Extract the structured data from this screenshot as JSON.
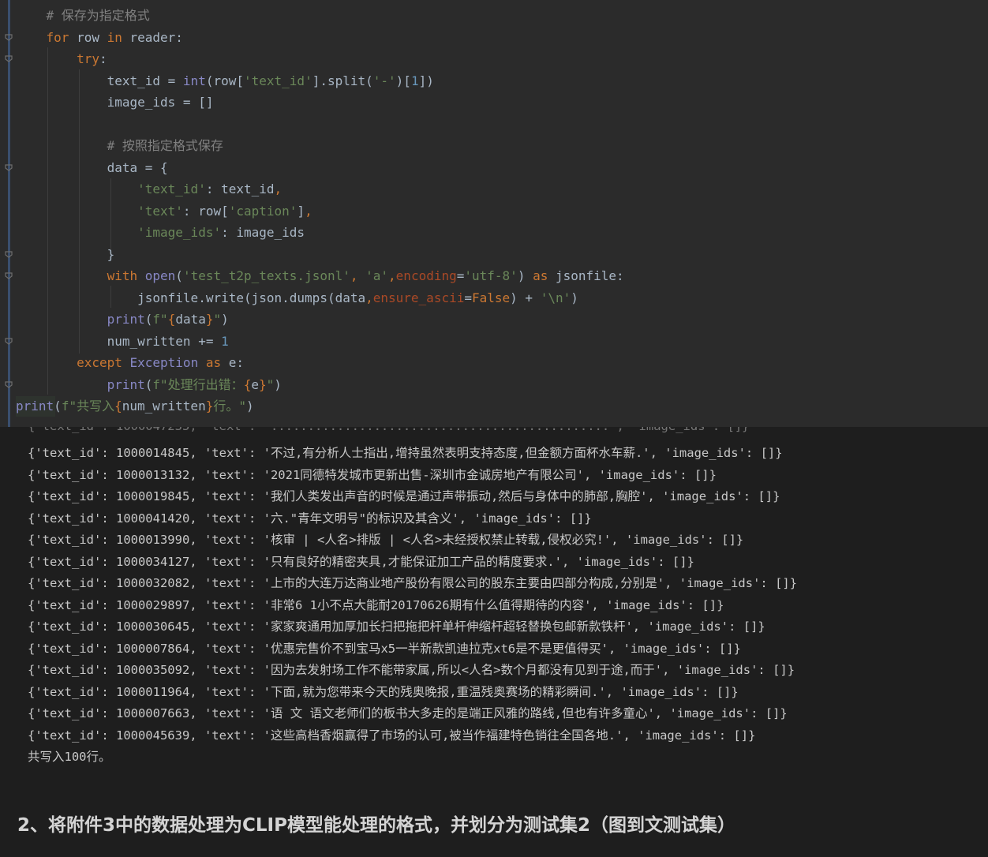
{
  "editor": {
    "lines": [
      [
        {
          "t": "    # 保存为指定格式",
          "c": "cmt"
        }
      ],
      [
        {
          "t": "    ",
          "c": "plain"
        },
        {
          "t": "for",
          "c": "kw"
        },
        {
          "t": " row ",
          "c": "plain"
        },
        {
          "t": "in",
          "c": "kw"
        },
        {
          "t": " reader:",
          "c": "plain"
        }
      ],
      [
        {
          "t": "        ",
          "c": "plain"
        },
        {
          "t": "try",
          "c": "kw"
        },
        {
          "t": ":",
          "c": "plain"
        }
      ],
      [
        {
          "t": "            text_id = ",
          "c": "plain"
        },
        {
          "t": "int",
          "c": "bi"
        },
        {
          "t": "(row[",
          "c": "plain"
        },
        {
          "t": "'text_id'",
          "c": "str"
        },
        {
          "t": "].split(",
          "c": "plain"
        },
        {
          "t": "'-'",
          "c": "str"
        },
        {
          "t": ")[",
          "c": "plain"
        },
        {
          "t": "1",
          "c": "num"
        },
        {
          "t": "])",
          "c": "plain"
        }
      ],
      [
        {
          "t": "            image_ids = []",
          "c": "plain"
        }
      ],
      [
        {
          "t": "",
          "c": "plain"
        }
      ],
      [
        {
          "t": "            # 按照指定格式保存",
          "c": "cmt"
        }
      ],
      [
        {
          "t": "            data = {",
          "c": "plain"
        }
      ],
      [
        {
          "t": "                ",
          "c": "plain"
        },
        {
          "t": "'text_id'",
          "c": "str"
        },
        {
          "t": ": text_id",
          "c": "plain"
        },
        {
          "t": ",",
          "c": "kw"
        }
      ],
      [
        {
          "t": "                ",
          "c": "plain"
        },
        {
          "t": "'text'",
          "c": "str"
        },
        {
          "t": ": row[",
          "c": "plain"
        },
        {
          "t": "'caption'",
          "c": "str"
        },
        {
          "t": "]",
          "c": "plain"
        },
        {
          "t": ",",
          "c": "kw"
        }
      ],
      [
        {
          "t": "                ",
          "c": "plain"
        },
        {
          "t": "'image_ids'",
          "c": "str"
        },
        {
          "t": ": image_ids",
          "c": "plain"
        }
      ],
      [
        {
          "t": "            }",
          "c": "plain"
        }
      ],
      [
        {
          "t": "            ",
          "c": "plain"
        },
        {
          "t": "with",
          "c": "kw"
        },
        {
          "t": " ",
          "c": "plain"
        },
        {
          "t": "open",
          "c": "bi"
        },
        {
          "t": "(",
          "c": "plain"
        },
        {
          "t": "'test_t2p_texts.jsonl'",
          "c": "str"
        },
        {
          "t": ", ",
          "c": "kw"
        },
        {
          "t": "'a'",
          "c": "str"
        },
        {
          "t": ",",
          "c": "kw"
        },
        {
          "t": "encoding",
          "c": "param"
        },
        {
          "t": "=",
          "c": "plain"
        },
        {
          "t": "'utf-8'",
          "c": "str"
        },
        {
          "t": ") ",
          "c": "plain"
        },
        {
          "t": "as",
          "c": "kw"
        },
        {
          "t": " jsonfile:",
          "c": "plain"
        }
      ],
      [
        {
          "t": "                jsonfile.write(json.dumps(data",
          "c": "plain"
        },
        {
          "t": ",",
          "c": "kw"
        },
        {
          "t": "ensure_ascii",
          "c": "param"
        },
        {
          "t": "=",
          "c": "plain"
        },
        {
          "t": "False",
          "c": "kw"
        },
        {
          "t": ") + ",
          "c": "plain"
        },
        {
          "t": "'\\n'",
          "c": "str"
        },
        {
          "t": ")",
          "c": "plain"
        }
      ],
      [
        {
          "t": "            ",
          "c": "plain"
        },
        {
          "t": "print",
          "c": "bi"
        },
        {
          "t": "(",
          "c": "plain"
        },
        {
          "t": "f\"",
          "c": "str"
        },
        {
          "t": "{",
          "c": "kw"
        },
        {
          "t": "data",
          "c": "plain"
        },
        {
          "t": "}",
          "c": "kw"
        },
        {
          "t": "\"",
          "c": "str"
        },
        {
          "t": ")",
          "c": "plain"
        }
      ],
      [
        {
          "t": "            num_written += ",
          "c": "plain"
        },
        {
          "t": "1",
          "c": "num"
        }
      ],
      [
        {
          "t": "        ",
          "c": "plain"
        },
        {
          "t": "except",
          "c": "kw"
        },
        {
          "t": " ",
          "c": "plain"
        },
        {
          "t": "Exception",
          "c": "bi"
        },
        {
          "t": " ",
          "c": "plain"
        },
        {
          "t": "as",
          "c": "kw"
        },
        {
          "t": " e:",
          "c": "plain"
        }
      ],
      [
        {
          "t": "            ",
          "c": "plain"
        },
        {
          "t": "print",
          "c": "bi"
        },
        {
          "t": "(",
          "c": "plain"
        },
        {
          "t": "f\"处理行出错：",
          "c": "str"
        },
        {
          "t": "{",
          "c": "kw"
        },
        {
          "t": "e",
          "c": "plain"
        },
        {
          "t": "}",
          "c": "kw"
        },
        {
          "t": "\"",
          "c": "str"
        },
        {
          "t": ")",
          "c": "plain"
        }
      ],
      [
        {
          "t": "print",
          "c": "bi"
        },
        {
          "t": "(",
          "c": "plain"
        },
        {
          "t": "f\"共写入",
          "c": "str"
        },
        {
          "t": "{",
          "c": "kw"
        },
        {
          "t": "num_written",
          "c": "plain"
        },
        {
          "t": "}",
          "c": "kw"
        },
        {
          "t": "行。\"",
          "c": "str"
        },
        {
          "t": ")",
          "c": "plain"
        }
      ]
    ],
    "colors": {
      "kw": "#cc7832",
      "str": "#6a8759",
      "num": "#6897bb",
      "cmt": "#808080",
      "bi": "#8888c6",
      "param": "#aa4926",
      "plain": "#a9b7c6"
    }
  },
  "console": {
    "lines": [
      "{'text_id': 1000014845, 'text': '不过,有分析人士指出,增持虽然表明支持态度,但金额方面杯水车薪.', 'image_ids': []}",
      "{'text_id': 1000013132, 'text': '2021同德特发城市更新出售-深圳市金诚房地产有限公司', 'image_ids': []}",
      "{'text_id': 1000019845, 'text': '我们人类发出声音的时候是通过声带振动,然后与身体中的肺部,胸腔', 'image_ids': []}",
      "{'text_id': 1000041420, 'text': '六.\"青年文明号\"的标识及其含义', 'image_ids': []}",
      "{'text_id': 1000013990, 'text': '核审 | <人名>排版 | <人名>未经授权禁止转载,侵权必究!', 'image_ids': []}",
      "{'text_id': 1000034127, 'text': '只有良好的精密夹具,才能保证加工产品的精度要求.', 'image_ids': []}",
      "{'text_id': 1000032082, 'text': '上市的大连万达商业地产股份有限公司的股东主要由四部分构成,分别是', 'image_ids': []}",
      "{'text_id': 1000029897, 'text': '非常6 1小不点大能耐20170626期有什么值得期待的内容', 'image_ids': []}",
      "{'text_id': 1000030645, 'text': '家家爽通用加厚加长扫把拖把杆单杆伸缩杆超轻替换包邮新款铁杆', 'image_ids': []}",
      "{'text_id': 1000007864, 'text': '优惠完售价不到宝马x5一半新款凯迪拉克xt6是不是更值得买', 'image_ids': []}",
      "{'text_id': 1000035092, 'text': '因为去发射场工作不能带家属,所以<人名>数个月都没有见到于途,而于', 'image_ids': []}",
      "{'text_id': 1000011964, 'text': '下面,就为您带来今天的残奥晚报,重温残奥赛场的精彩瞬间.', 'image_ids': []}",
      "{'text_id': 1000007663, 'text': '语 文 语文老师们的板书大多走的是端正风雅的路线,但也有许多童心', 'image_ids': []}",
      "{'text_id': 1000045639, 'text': '这些高档香烟赢得了市场的认可,被当作福建特色销往全国各地.', 'image_ids': []}",
      "共写入100行。"
    ]
  },
  "doc": {
    "heading": "2、将附件3中的数据处理为CLIP模型能处理的格式，并划分为测试集2（图到文测试集）"
  }
}
